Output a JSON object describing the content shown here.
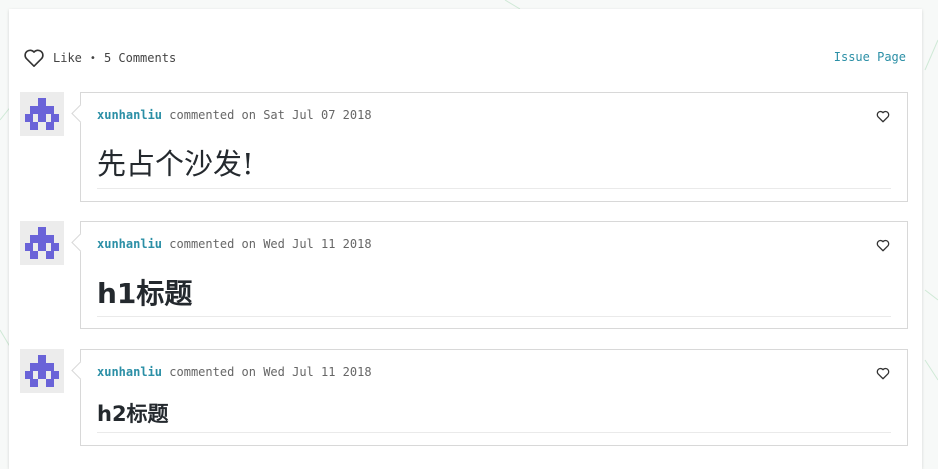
{
  "header": {
    "like_label": "Like",
    "separator": "•",
    "comments_label": "5 Comments",
    "issue_page_label": "Issue Page"
  },
  "comments": [
    {
      "author": "xunhanliu",
      "verb": "commented on",
      "date": "Sat Jul 07 2018",
      "body": "先占个沙发!",
      "style": "paragraph"
    },
    {
      "author": "xunhanliu",
      "verb": "commented on",
      "date": "Wed Jul 11 2018",
      "body": "h1标题",
      "style": "h1"
    },
    {
      "author": "xunhanliu",
      "verb": "commented on",
      "date": "Wed Jul 11 2018",
      "body": "h2标题",
      "style": "h2"
    }
  ],
  "icons": {
    "like": "heart-outline-icon",
    "comment_like": "heart-outline-icon",
    "avatar": "identicon-avatar"
  },
  "colors": {
    "link": "#2b8fa6",
    "avatar_fg": "#6a63d8",
    "text": "#24292e",
    "meta": "#666666"
  }
}
